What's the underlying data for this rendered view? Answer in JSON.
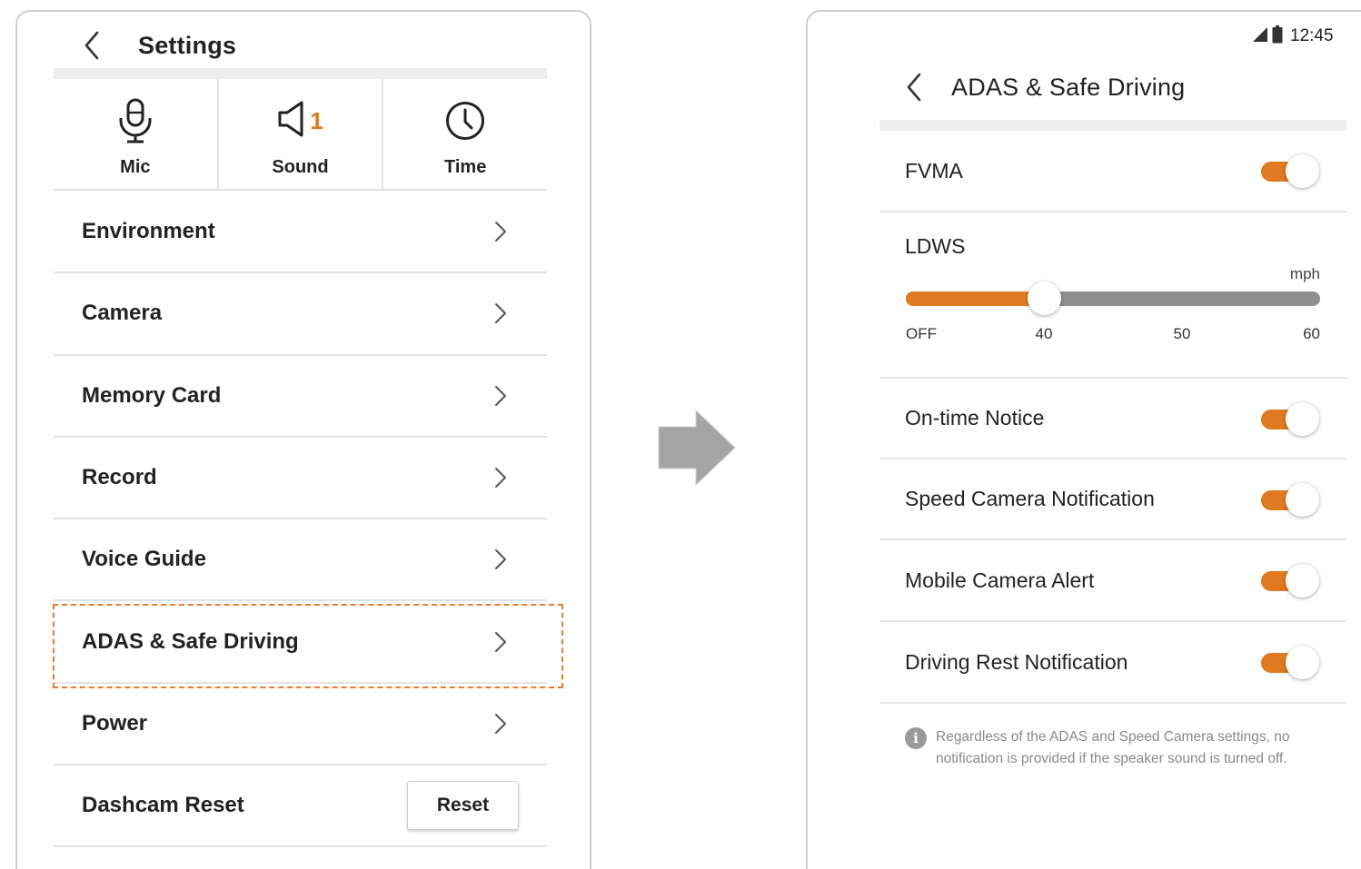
{
  "left_screen": {
    "header": {
      "title": "Settings"
    },
    "quick_settings": [
      {
        "label": "Mic",
        "icon": "mic-icon"
      },
      {
        "label": "Sound",
        "icon": "speaker-icon",
        "badge": "1"
      },
      {
        "label": "Time",
        "icon": "clock-icon"
      }
    ],
    "menu": [
      {
        "label": "Environment"
      },
      {
        "label": "Camera"
      },
      {
        "label": "Memory Card"
      },
      {
        "label": "Record"
      },
      {
        "label": "Voice Guide"
      },
      {
        "label": "ADAS & Safe Driving",
        "highlighted": true
      },
      {
        "label": "Power"
      }
    ],
    "reset_row": {
      "label": "Dashcam Reset",
      "button": "Reset"
    },
    "highlight_color": "#ea7d2e"
  },
  "transition_arrow": "right-arrow-icon",
  "right_screen": {
    "status_bar": {
      "time": "12:45",
      "icons": [
        "signal-icon",
        "battery-icon"
      ]
    },
    "header": {
      "title": "ADAS & Safe Driving"
    },
    "fvma": {
      "label": "FVMA",
      "enabled": true
    },
    "ldws": {
      "label": "LDWS",
      "unit": "mph",
      "ticks": [
        "OFF",
        "40",
        "50",
        "60"
      ],
      "selected": "40",
      "selected_index": 1
    },
    "toggles": [
      {
        "label": "On-time Notice",
        "enabled": true
      },
      {
        "label": "Speed Camera Notification",
        "enabled": true
      },
      {
        "label": "Mobile Camera Alert",
        "enabled": true
      },
      {
        "label": "Driving Rest Notification",
        "enabled": true
      }
    ],
    "info_note": "Regardless of the ADAS and Speed Camera settings, no notification is provided if the speaker sound is turned off.",
    "accent_color": "#e07a20"
  }
}
